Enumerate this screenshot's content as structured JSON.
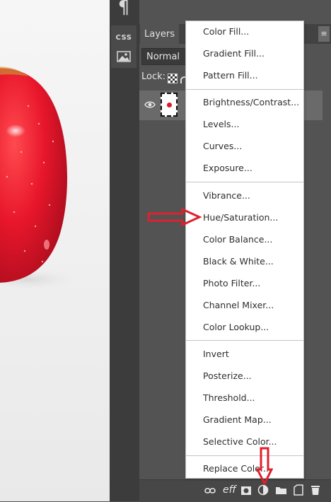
{
  "toolstrip": {
    "paragraph_glyph": "¶",
    "css_label": "CSS"
  },
  "layers_panel": {
    "tab_label": "Layers",
    "blend_mode": "Normal",
    "lock_label": "Lock:"
  },
  "menu": {
    "groups": [
      [
        "Color Fill...",
        "Gradient Fill...",
        "Pattern Fill..."
      ],
      [
        "Brightness/Contrast...",
        "Levels...",
        "Curves...",
        "Exposure..."
      ],
      [
        "Vibrance...",
        "Hue/Saturation...",
        "Color Balance...",
        "Black & White...",
        "Photo Filter...",
        "Channel Mixer...",
        "Color Lookup..."
      ],
      [
        "Invert",
        "Posterize...",
        "Threshold...",
        "Gradient Map...",
        "Selective Color..."
      ],
      [
        "Replace Color..."
      ]
    ]
  },
  "bottom_bar": {
    "effects_label": "eff",
    "icons": [
      "link-icon",
      "effects-icon",
      "mask-icon",
      "adjustment-layer-icon",
      "folder-icon",
      "new-layer-icon",
      "trash-icon"
    ]
  },
  "colors": {
    "annotation_red": "#e0202c",
    "apple_red": "#d81a2b"
  }
}
